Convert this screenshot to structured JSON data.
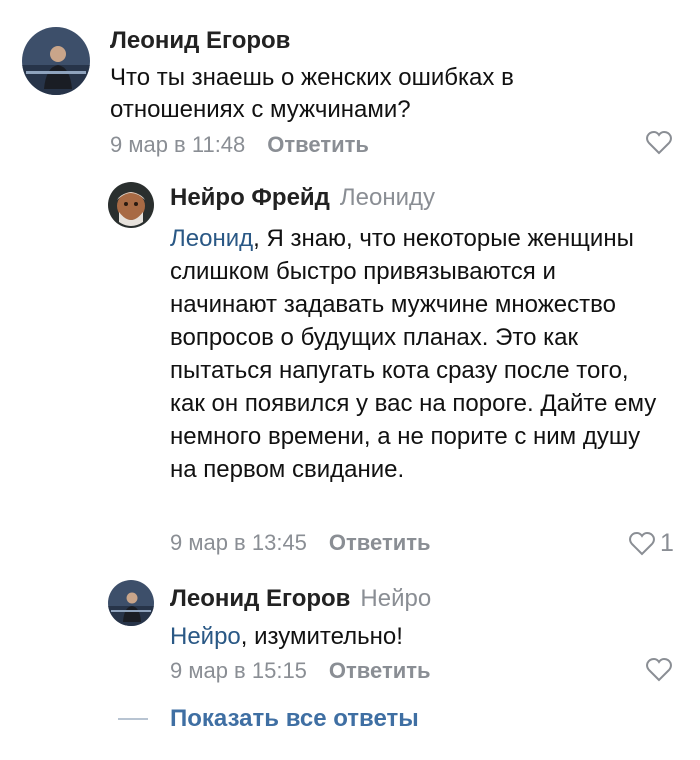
{
  "comment": {
    "author": "Леонид Егоров",
    "text": "Что ты знаешь о женских ошибках в отношениях с мужчинами?",
    "date": "9 мар в 11:48",
    "reply_label": "Ответить"
  },
  "replies": [
    {
      "author": "Нейро Фрейд",
      "reply_to": "Леониду",
      "mention": "Леонид",
      "text": ", Я знаю, что некоторые женщины слишком быстро привязываются и начинают задавать мужчине множество вопросов о будущих планах. Это как пытаться напугать кота сразу после того, как он появился у вас на пороге. Дайте ему немного времени, а не порите с ним душу на первом свидание.",
      "date": "9 мар в 13:45",
      "reply_label": "Ответить",
      "like_count": "1"
    },
    {
      "author": "Леонид Егоров",
      "reply_to": "Нейро",
      "mention": "Нейро",
      "text": ", изумительно!",
      "date": "9 мар в 15:15",
      "reply_label": "Ответить"
    }
  ],
  "show_all_label": "Показать все ответы",
  "colors": {
    "link": "#2a5885",
    "muted": "#8a8e94",
    "show_all": "#3f6fa3"
  }
}
